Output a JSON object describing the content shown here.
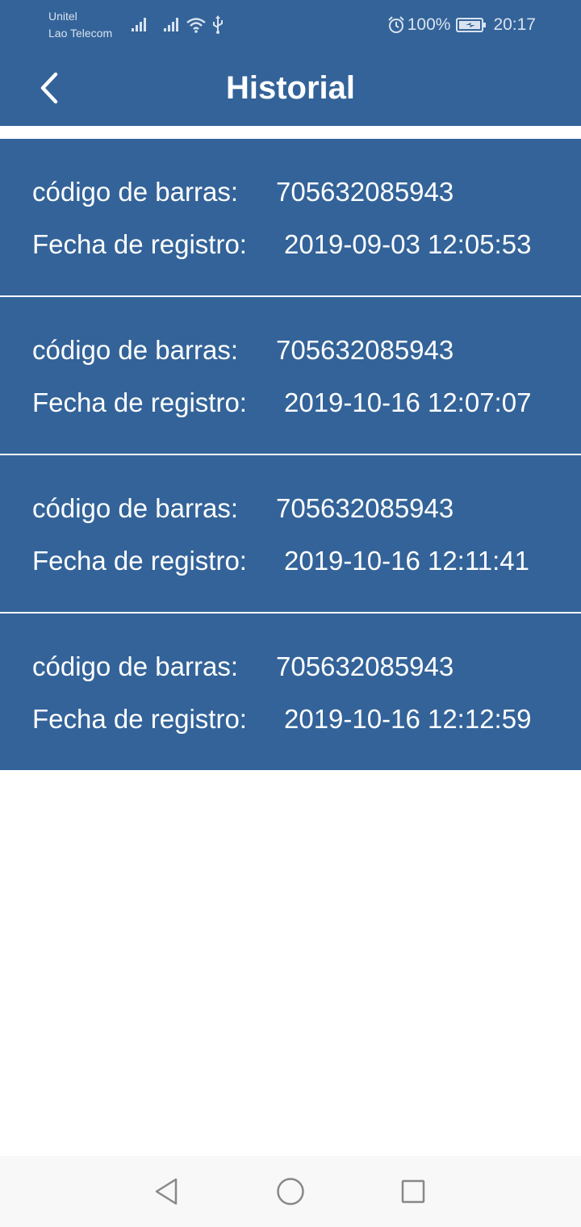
{
  "status_bar": {
    "carrier_1": "Unitel",
    "carrier_2": "Lao Telecom",
    "battery_percent": "100%",
    "time": "20:17",
    "icons": [
      "signal-icon",
      "signal-icon",
      "wifi-icon",
      "usb-icon",
      "alarm-icon",
      "battery-charging-icon"
    ]
  },
  "header": {
    "title": "Historial",
    "back_icon": "chevron-left-icon"
  },
  "records": [
    {
      "barcode_label": "código de barras:",
      "barcode": "705632085943",
      "date_label": "Fecha de registro:",
      "date": "2019-09-03 12:05:53"
    },
    {
      "barcode_label": "código de barras:",
      "barcode": "705632085943",
      "date_label": "Fecha de registro:",
      "date": "2019-10-16 12:07:07"
    },
    {
      "barcode_label": "código de barras:",
      "barcode": "705632085943",
      "date_label": "Fecha de registro:",
      "date": "2019-10-16 12:11:41"
    },
    {
      "barcode_label": "código de barras:",
      "barcode": "705632085943",
      "date_label": "Fecha de registro:",
      "date": "2019-10-16 12:12:59"
    }
  ],
  "nav_bar": {
    "icons": [
      "nav-back-icon",
      "nav-home-icon",
      "nav-recents-icon"
    ]
  },
  "colors": {
    "primary": "#336399",
    "text_on_primary": "#ffffff",
    "background": "#ffffff",
    "nav_bar": "#f8f8f8"
  }
}
